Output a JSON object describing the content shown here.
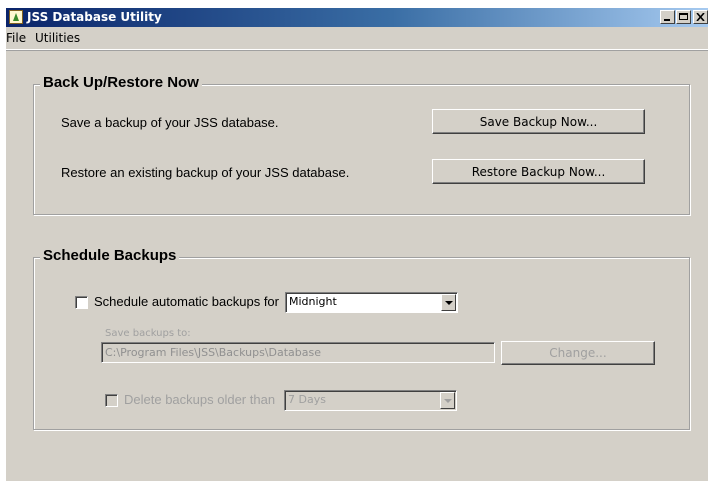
{
  "window": {
    "title": "JSS Database Utility",
    "app_icon": "jss-app-icon"
  },
  "menu": [
    "File",
    "Utilities"
  ],
  "backup_restore": {
    "title": "Back Up/Restore Now",
    "save_text": "Save a backup of your JSS database.",
    "save_button": "Save Backup Now...",
    "restore_text": "Restore an existing backup of your JSS database.",
    "restore_button": "Restore Backup Now..."
  },
  "schedule": {
    "title": "Schedule Backups",
    "schedule_label": "Schedule automatic backups for",
    "schedule_checked": false,
    "schedule_value": "Midnight",
    "save_to_label": "Save backups to:",
    "save_path": "C:\\Program Files\\JSS\\Backups\\Database",
    "change_button": "Change...",
    "delete_label": "Delete backups older than",
    "delete_checked": false,
    "delete_value": "7 Days"
  }
}
